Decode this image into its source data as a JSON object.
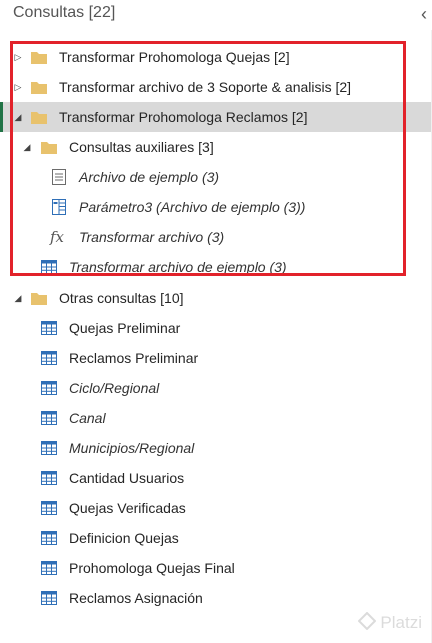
{
  "header": {
    "title": "Consultas [22]",
    "collapse_glyph": "‹"
  },
  "tree": {
    "group1": {
      "label": "Transformar Prohomologa Quejas [2]",
      "expanded": false,
      "icon": "folder-icon"
    },
    "group2": {
      "label": "Transformar archivo de 3 Soporte & analisis [2]",
      "expanded": false,
      "icon": "folder-icon"
    },
    "group3": {
      "label": "Transformar Prohomologa Reclamos [2]",
      "expanded": true,
      "selected": true,
      "icon": "folder-icon",
      "subgroup": {
        "label": "Consultas auxiliares [3]",
        "expanded": true,
        "icon": "folder-icon",
        "items": [
          {
            "label": "Archivo de ejemplo (3)",
            "icon": "text-file-icon"
          },
          {
            "label": "Parámetro3 (Archivo de ejemplo (3))",
            "icon": "parameter-icon"
          },
          {
            "label": "Transformar archivo (3)",
            "icon": "function-icon",
            "icon_glyph": "fx"
          }
        ]
      },
      "items": [
        {
          "label": "Transformar archivo de ejemplo (3)",
          "icon": "table-icon"
        }
      ]
    },
    "other": {
      "label": "Otras consultas [10]",
      "expanded": true,
      "icon": "folder-icon",
      "items": [
        {
          "label": "Quejas Preliminar",
          "italic": false,
          "icon": "table-icon"
        },
        {
          "label": "Reclamos Preliminar",
          "italic": false,
          "icon": "table-icon"
        },
        {
          "label": "Ciclo/Regional",
          "italic": true,
          "icon": "table-icon"
        },
        {
          "label": "Canal",
          "italic": true,
          "icon": "table-icon"
        },
        {
          "label": "Municipios/Regional",
          "italic": true,
          "icon": "table-icon"
        },
        {
          "label": "Cantidad Usuarios",
          "italic": false,
          "icon": "table-icon"
        },
        {
          "label": "Quejas Verificadas",
          "italic": false,
          "icon": "table-icon"
        },
        {
          "label": "Definicion Quejas",
          "italic": false,
          "icon": "table-icon"
        },
        {
          "label": "Prohomologa Quejas Final",
          "italic": false,
          "icon": "table-icon"
        },
        {
          "label": "Reclamos Asignación",
          "italic": false,
          "icon": "table-icon"
        }
      ]
    }
  },
  "highlight": {
    "color": "#e2222a"
  },
  "colors": {
    "folder": "#e8c26d",
    "table_icon": "#2f6fb7",
    "selection_bg": "#d9d9d9",
    "selection_marker": "#217346"
  },
  "watermark": {
    "text": "Platzi"
  }
}
